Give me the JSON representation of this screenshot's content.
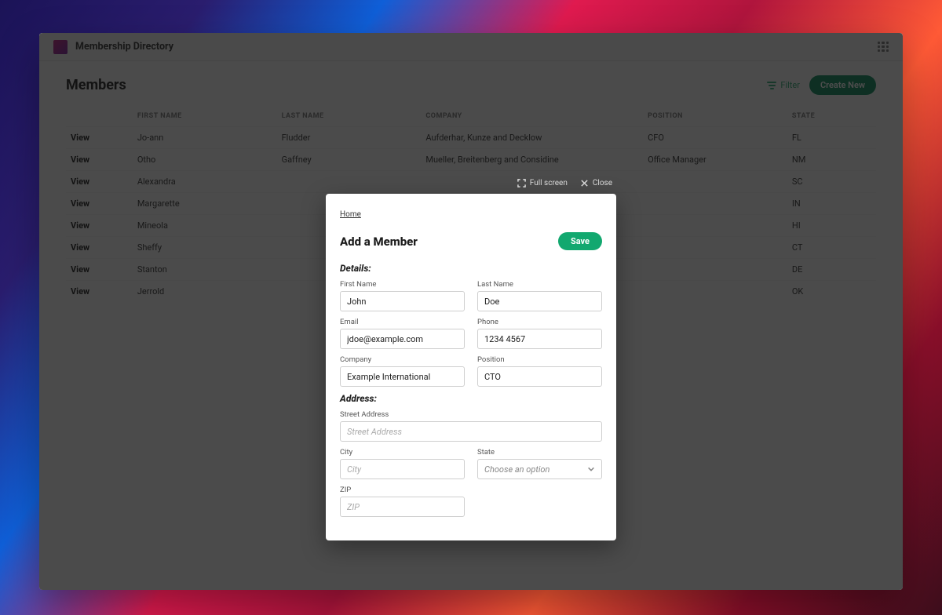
{
  "app": {
    "title": "Membership Directory"
  },
  "page": {
    "title": "Members",
    "filter_label": "Filter",
    "create_label": "Create New"
  },
  "table": {
    "columns": [
      "",
      "FIRST NAME",
      "LAST NAME",
      "COMPANY",
      "POSITION",
      "STATE"
    ],
    "view_label": "View",
    "rows": [
      {
        "first": "Jo-ann",
        "last": "Fludder",
        "company": "Aufderhar, Kunze and Decklow",
        "position": "CFO",
        "state": "FL"
      },
      {
        "first": "Otho",
        "last": "Gaffney",
        "company": "Mueller, Breitenberg and Considine",
        "position": "Office Manager",
        "state": "NM"
      },
      {
        "first": "Alexandra",
        "last": "",
        "company": "",
        "position": "",
        "state": "SC"
      },
      {
        "first": "Margarette",
        "last": "",
        "company": "",
        "position": "",
        "state": "IN"
      },
      {
        "first": "Mineola",
        "last": "",
        "company": "",
        "position": "",
        "state": "HI"
      },
      {
        "first": "Sheffy",
        "last": "",
        "company": "",
        "position": "",
        "state": "CT"
      },
      {
        "first": "Stanton",
        "last": "",
        "company": "",
        "position": "",
        "state": "DE"
      },
      {
        "first": "Jerrold",
        "last": "",
        "company": "",
        "position": "",
        "state": "OK"
      }
    ]
  },
  "modal_tools": {
    "fullscreen": "Full screen",
    "close": "Close"
  },
  "modal": {
    "breadcrumb": "Home",
    "title": "Add a Member",
    "save_label": "Save",
    "sections": {
      "details": "Details:",
      "address": "Address:"
    },
    "fields": {
      "first_name": {
        "label": "First Name",
        "value": "John"
      },
      "last_name": {
        "label": "Last Name",
        "value": "Doe"
      },
      "email": {
        "label": "Email",
        "value": "jdoe@example.com"
      },
      "phone": {
        "label": "Phone",
        "value": "1234 4567"
      },
      "company": {
        "label": "Company",
        "value": "Example International"
      },
      "position": {
        "label": "Position",
        "value": "CTO"
      },
      "street": {
        "label": "Street Address",
        "placeholder": "Street Address"
      },
      "city": {
        "label": "City",
        "placeholder": "City"
      },
      "state": {
        "label": "State",
        "placeholder": "Choose an option"
      },
      "zip": {
        "label": "ZIP",
        "placeholder": "ZIP"
      }
    }
  }
}
